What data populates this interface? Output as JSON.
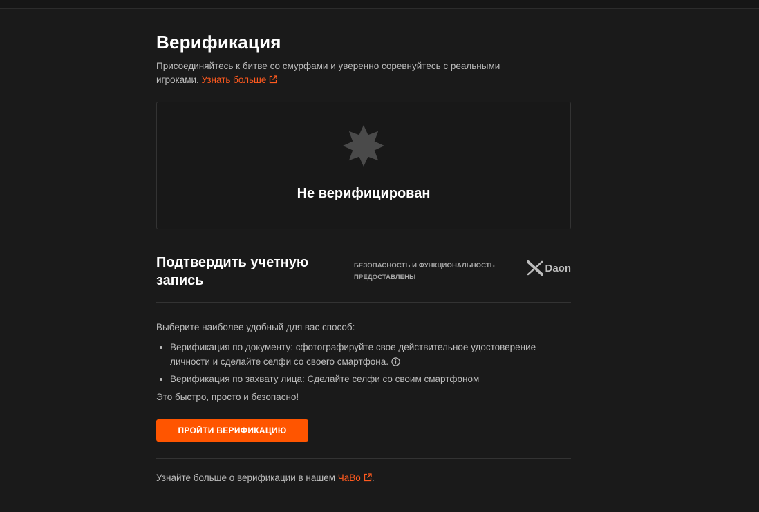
{
  "page": {
    "title": "Верификация",
    "subtitle": "Присоединяйтесь к битве со смурфами и уверенно соревнуйтесь с реальными игроками.",
    "learn_more_link": "Узнать больше"
  },
  "status": {
    "label": "Не верифицирован"
  },
  "confirm": {
    "title": "Подтвердить учетную запись",
    "provider_text": "Безопасность и функциональность предоставлены",
    "provider_name": "Daon"
  },
  "methods": {
    "intro": "Выберите наиболее удобный для вас способ:",
    "items": [
      "Верификация по документу: сфотографируйте свое действительное удостоверение личности и сделайте селфи со своего смартфона.",
      "Верификация по захвату лица: Сделайте селфи со своим смартфоном"
    ],
    "outro": "Это быстро, просто и безопасно!"
  },
  "cta": {
    "label": "Пройти верификацию"
  },
  "faq": {
    "prefix": "Узнайте больше о верификации в нашем",
    "link": "ЧаВо",
    "suffix": "."
  },
  "colors": {
    "accent": "#ff5500",
    "link": "#ff5a1f",
    "background": "#1a1a1a"
  },
  "icons": {
    "status": "unverified-badge-icon",
    "external": "external-link-icon",
    "info": "info-icon",
    "provider": "daon-logo-icon"
  }
}
